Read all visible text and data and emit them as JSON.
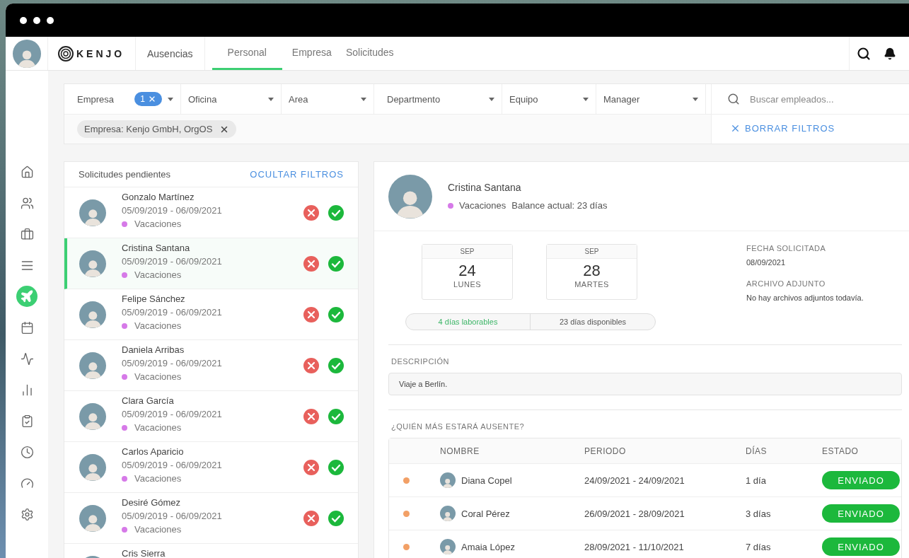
{
  "nav": {
    "logo": "KENJO",
    "section": "Ausencias",
    "tabs": [
      {
        "label": "Personal",
        "selected": true
      },
      {
        "label": "Empresa",
        "selected": false
      },
      {
        "label": "Solicitudes",
        "selected": false
      }
    ]
  },
  "sidebar": {
    "items": [
      {
        "kind": "home",
        "selected": false
      },
      {
        "kind": "people",
        "selected": false
      },
      {
        "kind": "briefcase",
        "selected": false
      },
      {
        "kind": "list",
        "selected": false
      },
      {
        "kind": "plane",
        "selected": true
      },
      {
        "kind": "calendar",
        "selected": false
      },
      {
        "kind": "pulse",
        "selected": false
      },
      {
        "kind": "chart",
        "selected": false
      },
      {
        "kind": "checklist",
        "selected": false
      },
      {
        "kind": "clock",
        "selected": false
      },
      {
        "kind": "gauge",
        "selected": false
      },
      {
        "kind": "gear",
        "selected": false
      }
    ]
  },
  "filters": {
    "dropdowns": [
      {
        "label": "Empresa",
        "count": "1"
      },
      {
        "label": "Oficina"
      },
      {
        "label": "Area"
      },
      {
        "label": "Departmento"
      },
      {
        "label": "Equipo"
      },
      {
        "label": "Manager"
      }
    ],
    "chips": [
      "Empresa: Kenjo GmbH, OrgOS"
    ],
    "search": {
      "placeholder": "Buscar empleados..."
    },
    "clear_button": "BORRAR FILTROS"
  },
  "requests": {
    "title": "Solicitudes pendientes",
    "toggle": "OCULTAR FILTROS",
    "rows": [
      {
        "name": "Gonzalo Martínez",
        "period": "05/09/2019 - 06/09/2021",
        "type": "Vacaciones",
        "color": "#d67ae8",
        "selected": false
      },
      {
        "name": "Cristina Santana",
        "period": "05/09/2019 - 06/09/2021",
        "type": "Vacaciones",
        "color": "#d67ae8",
        "selected": true
      },
      {
        "name": "Felipe Sánchez",
        "period": "05/09/2019 - 06/09/2021",
        "type": "Vacaciones",
        "color": "#d67ae8",
        "selected": false
      },
      {
        "name": "Daniela Arribas",
        "period": "05/09/2019 - 06/09/2021",
        "type": "Vacaciones",
        "color": "#d67ae8",
        "selected": false
      },
      {
        "name": "Clara García",
        "period": "05/09/2019 - 06/09/2021",
        "type": "Vacaciones",
        "color": "#d67ae8",
        "selected": false
      },
      {
        "name": "Carlos Aparicio",
        "period": "05/09/2019 - 06/09/2021",
        "type": "Vacaciones",
        "color": "#d67ae8",
        "selected": false
      },
      {
        "name": "Desiré Gómez",
        "period": "05/09/2019 - 06/09/2021",
        "type": "Vacaciones",
        "color": "#d67ae8",
        "selected": false
      },
      {
        "name": "Cris Sierra",
        "selected": false
      }
    ]
  },
  "detail": {
    "name": "Cristina Santana",
    "type": {
      "label": "Vacaciones",
      "color": "#d67ae8"
    },
    "balance": "Balance actual: 23 días",
    "dates": [
      {
        "month": "SEP",
        "day": "24",
        "weekday": "LUNES"
      },
      {
        "month": "SEP",
        "day": "28",
        "weekday": "MARTES"
      }
    ],
    "working_days": "4 días laborables",
    "available_days": "23 días disponibles",
    "requested_label": "FECHA SOLICITADA",
    "requested_date": "08/09/2021",
    "attachment_label": "ARCHIVO ADJUNTO",
    "attachment_text": "No hay archivos adjuntos todavía.",
    "description_label": "DESCRIPCIÓN",
    "description": "Viaje a Berlín.",
    "others_title": "¿QUIÉN MÁS ESTARÁ AUSENTE?",
    "others": {
      "columns": [
        "NOMBRE",
        "PERIODO",
        "DÍAS",
        "ESTADO"
      ],
      "rows": [
        {
          "name": "Diana Copel",
          "period": "24/09/2021 - 24/09/2021",
          "days": "1 día",
          "status": "ENVIADO",
          "color": "#f2a066"
        },
        {
          "name": "Coral Pérez",
          "period": "26/09/2021 - 28/09/2021",
          "days": "3 días",
          "status": "ENVIADO",
          "color": "#f2a066"
        },
        {
          "name": "Amaia López",
          "period": "28/09/2021 - 11/10/2021",
          "days": "7 días",
          "status": "ENVIADO",
          "color": "#f2a066"
        }
      ]
    }
  }
}
